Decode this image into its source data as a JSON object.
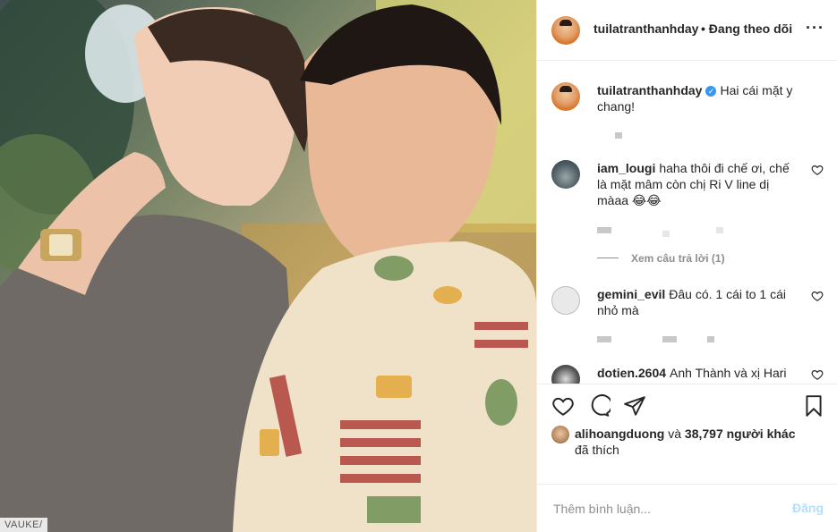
{
  "post": {
    "owner": "tuilatranthanhday",
    "follow_status": "• Đang theo dõi",
    "caption": "Hai cái mặt y chang!",
    "watermark": "VAUKE/"
  },
  "comments": [
    {
      "user": "iam_lougi",
      "text": "haha thôi đi chế ơi, chế là mặt mâm còn chị Ri V line dị màaa 😂😂",
      "replies": "Xem câu trả lời (1)"
    },
    {
      "user": "gemini_evil",
      "text": "Đâu có. 1 cái to 1 cái nhỏ mà"
    },
    {
      "user": "dotien.2604",
      "text": "Anh Thành và xị Hari"
    }
  ],
  "likes": {
    "user": "alihoangduong",
    "connector": "và",
    "others": "38,797 người khác",
    "suffix": "đã thích"
  },
  "add_comment": {
    "placeholder": "Thêm bình luận...",
    "post_label": "Đăng"
  },
  "icons": [
    "more-icon",
    "verified-icon",
    "heart-icon",
    "comment-icon",
    "share-icon",
    "bookmark-icon"
  ],
  "colors": {
    "verified": "#3897f0",
    "post_disabled": "#b2dffc",
    "muted": "#8e8e8e"
  }
}
